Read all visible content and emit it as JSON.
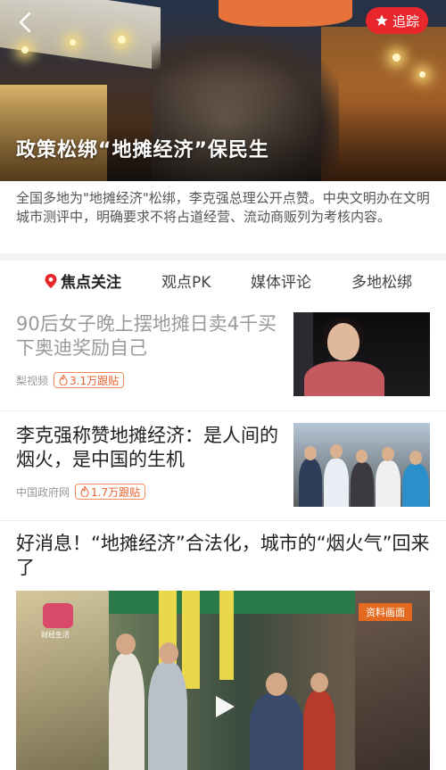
{
  "hero": {
    "title": "政策松绑“地摊经济”保民生",
    "follow_label": "追踪"
  },
  "summary": "全国多地为\"地摊经济\"松绑，李克强总理公开点赞。中央文明办在文明城市测评中，明确要求不将占道经营、流动商贩列为考核内容。",
  "tabs": [
    {
      "label": "焦点关注",
      "active": true
    },
    {
      "label": "观点PK",
      "active": false
    },
    {
      "label": "媒体评论",
      "active": false
    },
    {
      "label": "多地松绑",
      "active": false
    }
  ],
  "news": [
    {
      "title": "90后女子晚上摆地摊日卖4千买下奥迪奖励自己",
      "source": "梨视频",
      "followers": "3.1万跟贴",
      "read": true
    },
    {
      "title": "李克强称赞地摊经济：是人间的烟火，是中国的生机",
      "source": "中国政府网",
      "followers": "1.7万跟贴",
      "read": false
    },
    {
      "title": "好消息！“地摊经济”合法化，城市的“烟火气”回来了",
      "video_tag": "资料画面",
      "video_logo_text": "财经生活"
    }
  ],
  "colors": {
    "accent": "#e8262b",
    "badge": "#e8602c",
    "read_text": "#9a9a9a"
  },
  "icons": {
    "back": "chevron-left-icon",
    "star": "star-icon",
    "location": "location-pin-icon",
    "fire": "fire-icon",
    "play": "play-icon"
  }
}
